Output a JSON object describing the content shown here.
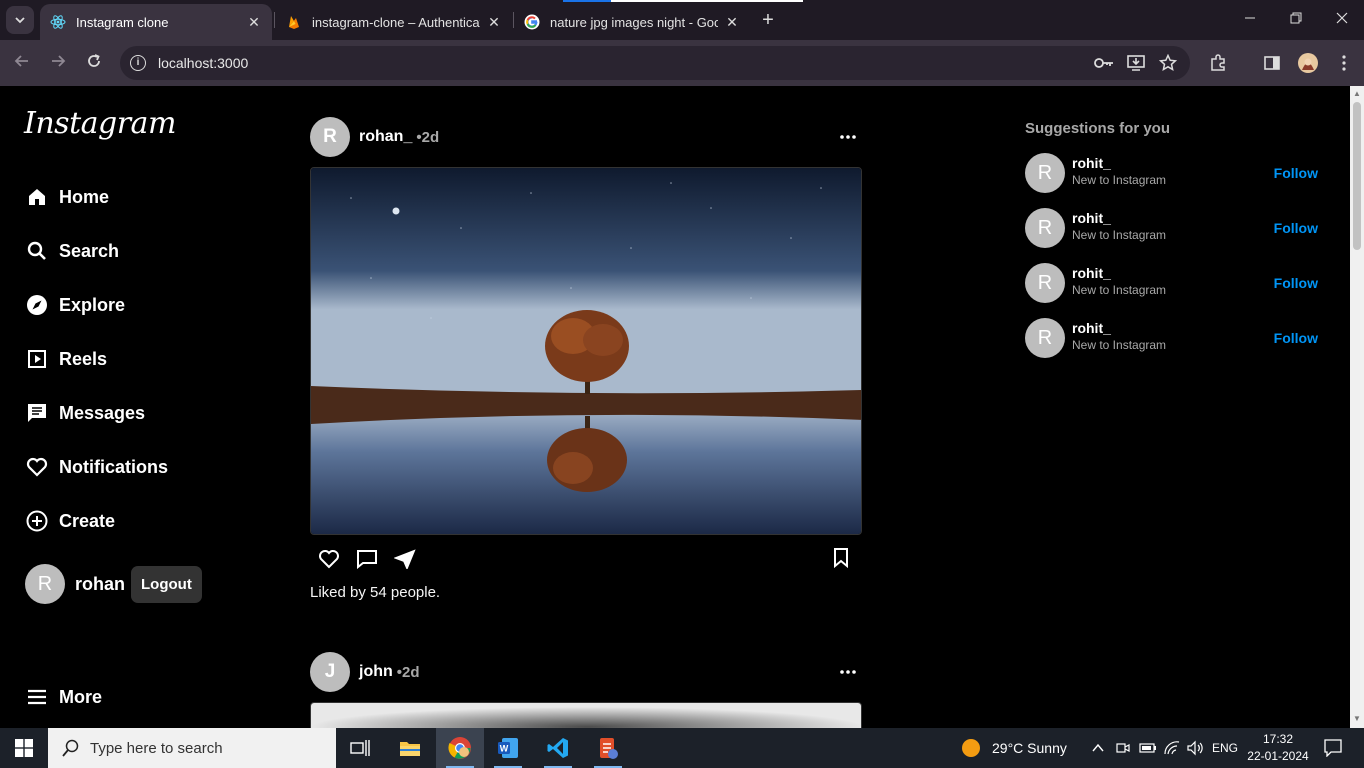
{
  "browser": {
    "tabs": [
      {
        "title": "Instagram clone",
        "active": true,
        "favicon": "react-icon"
      },
      {
        "title": "instagram-clone – Authenticatic",
        "active": false,
        "favicon": "firebase-icon"
      },
      {
        "title": "nature jpg images night - Goog",
        "active": false,
        "favicon": "google-icon"
      }
    ],
    "close_glyph": "✕",
    "new_tab_glyph": "+",
    "url": "localhost:3000"
  },
  "sidebar": {
    "logo": "Instagram",
    "items": [
      {
        "label": "Home",
        "icon": "home-icon"
      },
      {
        "label": "Search",
        "icon": "search-icon"
      },
      {
        "label": "Explore",
        "icon": "compass-icon"
      },
      {
        "label": "Reels",
        "icon": "reels-icon"
      },
      {
        "label": "Messages",
        "icon": "messages-icon"
      },
      {
        "label": "Notifications",
        "icon": "heart-icon"
      },
      {
        "label": "Create",
        "icon": "plus-circle-icon"
      }
    ],
    "profile": {
      "initial": "R",
      "name": "rohan",
      "logout_label": "Logout"
    },
    "more_label": "More"
  },
  "feed": {
    "posts": [
      {
        "initial": "R",
        "username": "rohan_",
        "time": "•2d",
        "likes_text": "Liked by 54 people."
      },
      {
        "initial": "J",
        "username": "john",
        "time": "•2d"
      }
    ]
  },
  "suggestions": {
    "title": "Suggestions for you",
    "items": [
      {
        "initial": "R",
        "username": "rohit_",
        "subtitle": "New to Instagram",
        "action": "Follow"
      },
      {
        "initial": "R",
        "username": "rohit_",
        "subtitle": "New to Instagram",
        "action": "Follow"
      },
      {
        "initial": "R",
        "username": "rohit_",
        "subtitle": "New to Instagram",
        "action": "Follow"
      },
      {
        "initial": "R",
        "username": "rohit_",
        "subtitle": "New to Instagram",
        "action": "Follow"
      }
    ]
  },
  "taskbar": {
    "search_placeholder": "Type here to search",
    "weather": "29°C  Sunny",
    "language": "ENG",
    "time": "17:32",
    "date": "22-01-2024"
  },
  "colors": {
    "accent": "#0095f6",
    "page_bg": "#000000",
    "chrome_bg": "#3a3340"
  }
}
